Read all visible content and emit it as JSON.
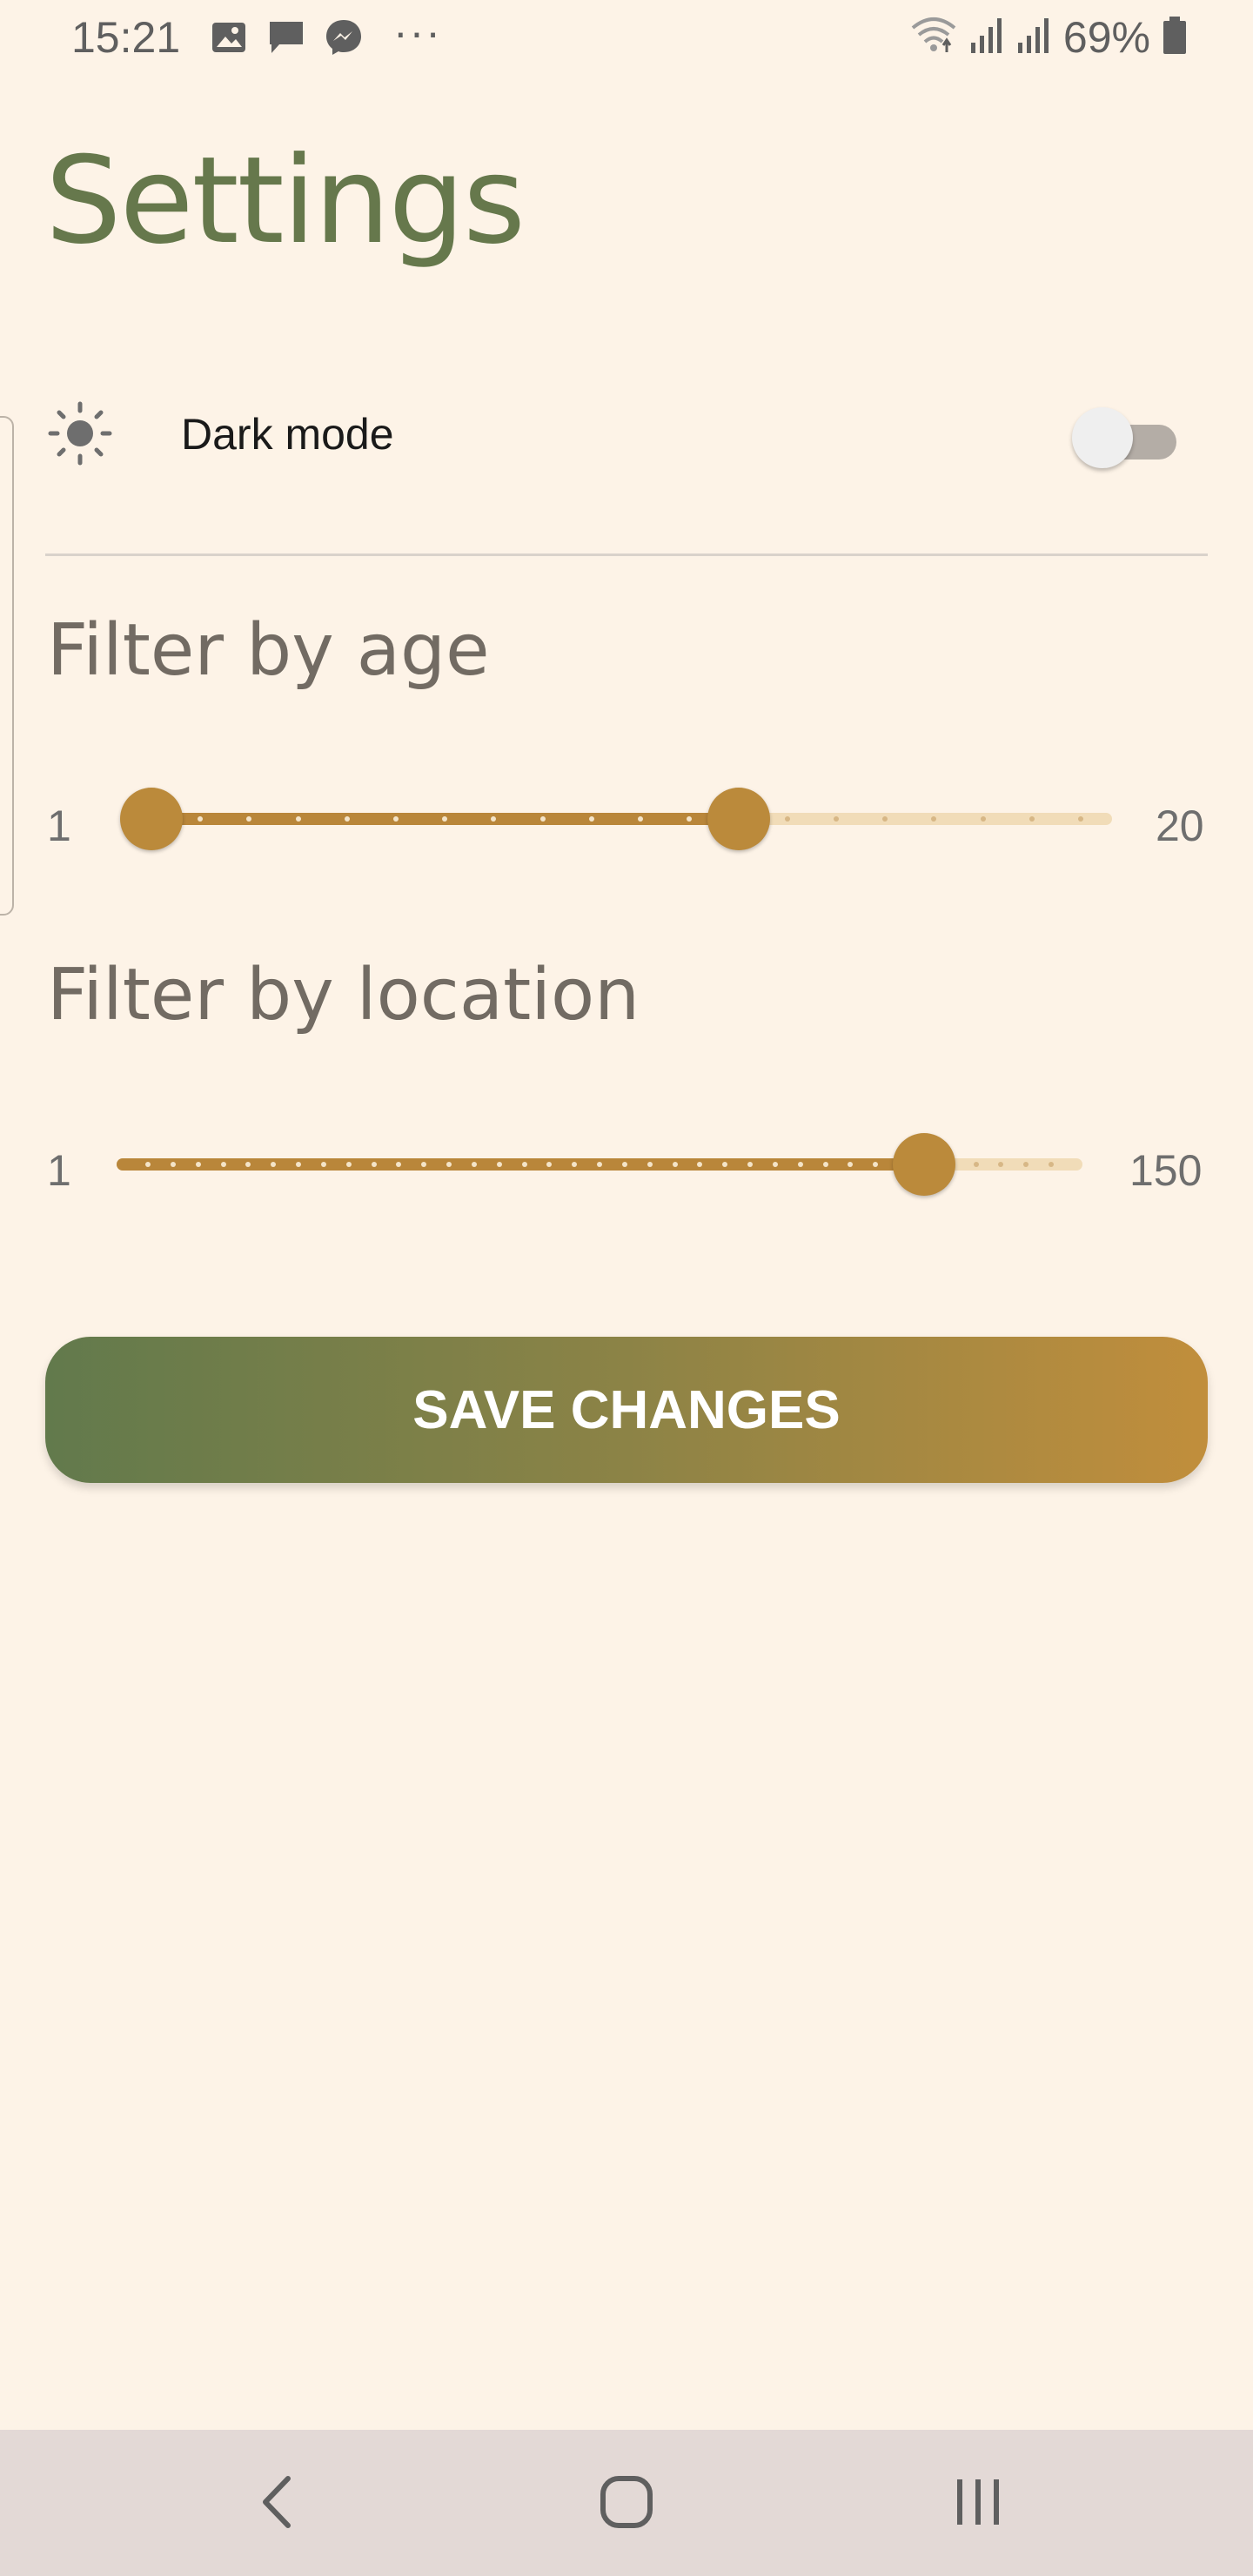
{
  "status_bar": {
    "time": "15:21",
    "left_icons": [
      "gallery-icon",
      "message-icon",
      "messenger-icon"
    ],
    "more": "···",
    "battery": "69%",
    "right_icons": [
      "wifi-icon",
      "signal-icon",
      "signal-icon",
      "battery-icon"
    ]
  },
  "page": {
    "title": "Settings"
  },
  "dark_mode": {
    "icon": "sun-icon",
    "label": "Dark mode",
    "enabled": false
  },
  "age_filter": {
    "title": "Filter by age",
    "min_label": "1",
    "max_label": "20",
    "min": 1,
    "max": 20,
    "selected_low": 1,
    "selected_high": 13
  },
  "location_filter": {
    "title": "Filter by location",
    "min_label": "1",
    "max_label": "150",
    "min": 1,
    "max": 150,
    "selected": 129
  },
  "actions": {
    "save_label": "SAVE CHANGES"
  },
  "colors": {
    "background": "#fdf3e7",
    "title_green": "#66784c",
    "accent_gold": "#bb8a3b",
    "track_light": "#f1dcb8"
  },
  "nav_bar": {
    "icons": [
      "back-icon",
      "home-icon",
      "recents-icon"
    ]
  }
}
